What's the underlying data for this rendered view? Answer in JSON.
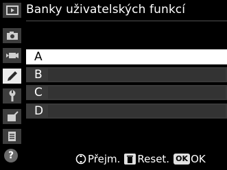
{
  "title": "Banky uživatelských funkcí",
  "sidebar": {
    "items": [
      {
        "icon": "playback-icon",
        "active": false
      },
      {
        "icon": "camera-icon",
        "active": false
      },
      {
        "icon": "movie-icon",
        "active": false
      },
      {
        "icon": "pencil-icon",
        "active": true
      },
      {
        "icon": "wrench-icon",
        "active": false
      },
      {
        "icon": "retouch-icon",
        "active": false
      },
      {
        "icon": "my-menu-icon",
        "active": false
      }
    ],
    "help_label": "?"
  },
  "options": [
    {
      "label": "A",
      "selected": true
    },
    {
      "label": "B",
      "selected": false
    },
    {
      "label": "C",
      "selected": false
    },
    {
      "label": "D",
      "selected": false
    }
  ],
  "footer": {
    "move_label": "Přejm.",
    "reset_label": "Reset.",
    "ok_badge": "OK",
    "ok_label": "OK"
  },
  "colors": {
    "selected_bg": "#ffffff",
    "row_bg": "#3a3a3a",
    "accent": "#f0c800"
  }
}
